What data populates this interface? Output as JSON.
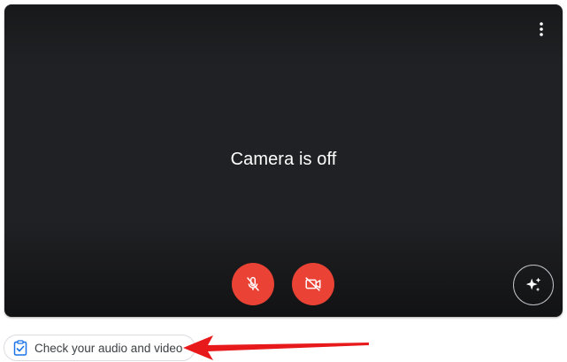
{
  "preview": {
    "status_text": "Camera is off",
    "background_color": "#202124"
  },
  "controls": {
    "more_options_icon": "vertical-dots-icon",
    "mic_icon": "mic-off-icon",
    "camera_icon": "videocam-off-icon",
    "effects_icon": "sparkle-icon",
    "off_color": "#ea4335"
  },
  "check_audio_video": {
    "label": "Check your audio and video",
    "icon": "clipboard-check-icon",
    "icon_color": "#1a73e8"
  },
  "annotation": {
    "arrow_color": "#e8191b"
  }
}
